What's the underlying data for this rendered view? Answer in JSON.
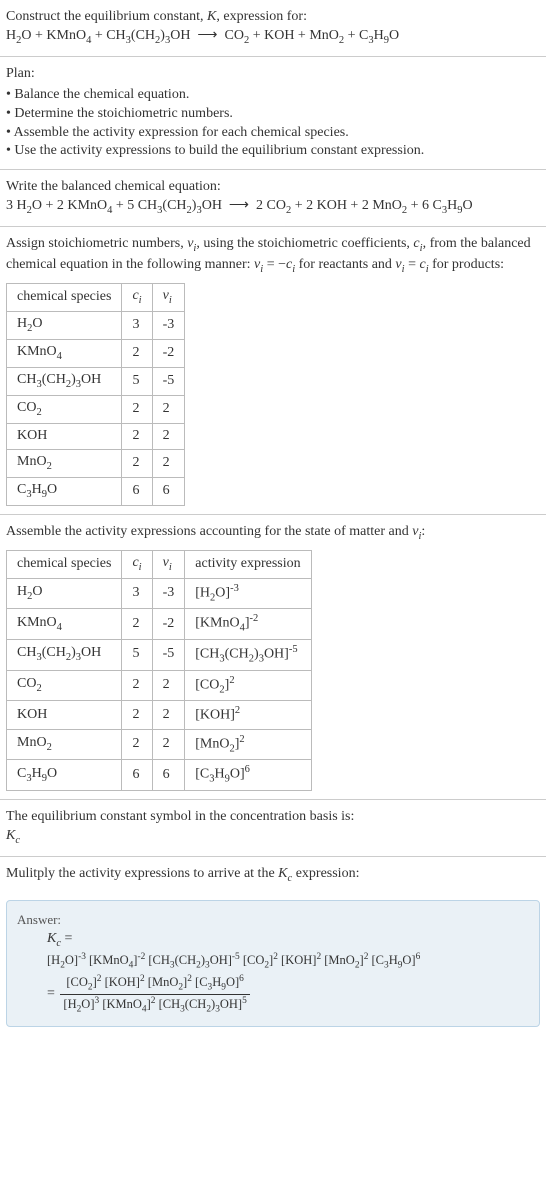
{
  "intro": {
    "line1_html": "Construct the equilibrium constant, <span class='ital'>K</span>, expression for:",
    "eq_html": "H<sub>2</sub>O + KMnO<sub>4</sub> + CH<sub>3</sub>(CH<sub>2</sub>)<sub>3</sub>OH &nbsp;⟶&nbsp; CO<sub>2</sub> + KOH + MnO<sub>2</sub> + C<sub>3</sub>H<sub>9</sub>O"
  },
  "plan": {
    "title": "Plan:",
    "items": [
      "Balance the chemical equation.",
      "Determine the stoichiometric numbers.",
      "Assemble the activity expression for each chemical species.",
      "Use the activity expressions to build the equilibrium constant expression."
    ]
  },
  "balanced": {
    "title": "Write the balanced chemical equation:",
    "eq_html": "3 H<sub>2</sub>O + 2 KMnO<sub>4</sub> + 5 CH<sub>3</sub>(CH<sub>2</sub>)<sub>3</sub>OH &nbsp;⟶&nbsp; 2 CO<sub>2</sub> + 2 KOH + 2 MnO<sub>2</sub> + 6 C<sub>3</sub>H<sub>9</sub>O"
  },
  "assign": {
    "text_html": "Assign stoichiometric numbers, <span class='ital'>ν<sub>i</sub></span>, using the stoichiometric coefficients, <span class='ital'>c<sub>i</sub></span>, from the balanced chemical equation in the following manner: <span class='ital'>ν<sub>i</sub></span> = −<span class='ital'>c<sub>i</sub></span> for reactants and <span class='ital'>ν<sub>i</sub></span> = <span class='ital'>c<sub>i</sub></span> for products:"
  },
  "table1": {
    "headers_html": [
      "chemical species",
      "<span class='ital'>c<sub>i</sub></span>",
      "<span class='ital'>ν<sub>i</sub></span>"
    ],
    "rows_html": [
      [
        "H<sub>2</sub>O",
        "3",
        "-3"
      ],
      [
        "KMnO<sub>4</sub>",
        "2",
        "-2"
      ],
      [
        "CH<sub>3</sub>(CH<sub>2</sub>)<sub>3</sub>OH",
        "5",
        "-5"
      ],
      [
        "CO<sub>2</sub>",
        "2",
        "2"
      ],
      [
        "KOH",
        "2",
        "2"
      ],
      [
        "MnO<sub>2</sub>",
        "2",
        "2"
      ],
      [
        "C<sub>3</sub>H<sub>9</sub>O",
        "6",
        "6"
      ]
    ]
  },
  "assemble": {
    "text_html": "Assemble the activity expressions accounting for the state of matter and <span class='ital'>ν<sub>i</sub></span>:"
  },
  "table2": {
    "headers_html": [
      "chemical species",
      "<span class='ital'>c<sub>i</sub></span>",
      "<span class='ital'>ν<sub>i</sub></span>",
      "activity expression"
    ],
    "rows_html": [
      [
        "H<sub>2</sub>O",
        "3",
        "-3",
        "[H<sub>2</sub>O]<sup>-3</sup>"
      ],
      [
        "KMnO<sub>4</sub>",
        "2",
        "-2",
        "[KMnO<sub>4</sub>]<sup>-2</sup>"
      ],
      [
        "CH<sub>3</sub>(CH<sub>2</sub>)<sub>3</sub>OH",
        "5",
        "-5",
        "[CH<sub>3</sub>(CH<sub>2</sub>)<sub>3</sub>OH]<sup>-5</sup>"
      ],
      [
        "CO<sub>2</sub>",
        "2",
        "2",
        "[CO<sub>2</sub>]<sup>2</sup>"
      ],
      [
        "KOH",
        "2",
        "2",
        "[KOH]<sup>2</sup>"
      ],
      [
        "MnO<sub>2</sub>",
        "2",
        "2",
        "[MnO<sub>2</sub>]<sup>2</sup>"
      ],
      [
        "C<sub>3</sub>H<sub>9</sub>O",
        "6",
        "6",
        "[C<sub>3</sub>H<sub>9</sub>O]<sup>6</sup>"
      ]
    ]
  },
  "kc_symbol": {
    "line1": "The equilibrium constant symbol in the concentration basis is:",
    "line2_html": "<span class='ital'>K<sub>c</sub></span>"
  },
  "multiply": {
    "text_html": "Mulitply the activity expressions to arrive at the <span class='ital'>K<sub>c</sub></span> expression:"
  },
  "answer": {
    "label": "Answer:",
    "kc_html": "<span class='ital'>K<sub>c</sub></span> =",
    "top_line_html": "[H<sub>2</sub>O]<sup>-3</sup> [KMnO<sub>4</sub>]<sup>-2</sup> [CH<sub>3</sub>(CH<sub>2</sub>)<sub>3</sub>OH]<sup>-5</sup> [CO<sub>2</sub>]<sup>2</sup> [KOH]<sup>2</sup> [MnO<sub>2</sub>]<sup>2</sup> [C<sub>3</sub>H<sub>9</sub>O]<sup>6</sup>",
    "frac_num_html": "[CO<sub>2</sub>]<sup>2</sup> [KOH]<sup>2</sup> [MnO<sub>2</sub>]<sup>2</sup> [C<sub>3</sub>H<sub>9</sub>O]<sup>6</sup>",
    "frac_den_html": "[H<sub>2</sub>O]<sup>3</sup> [KMnO<sub>4</sub>]<sup>2</sup> [CH<sub>3</sub>(CH<sub>2</sub>)<sub>3</sub>OH]<sup>5</sup>"
  }
}
